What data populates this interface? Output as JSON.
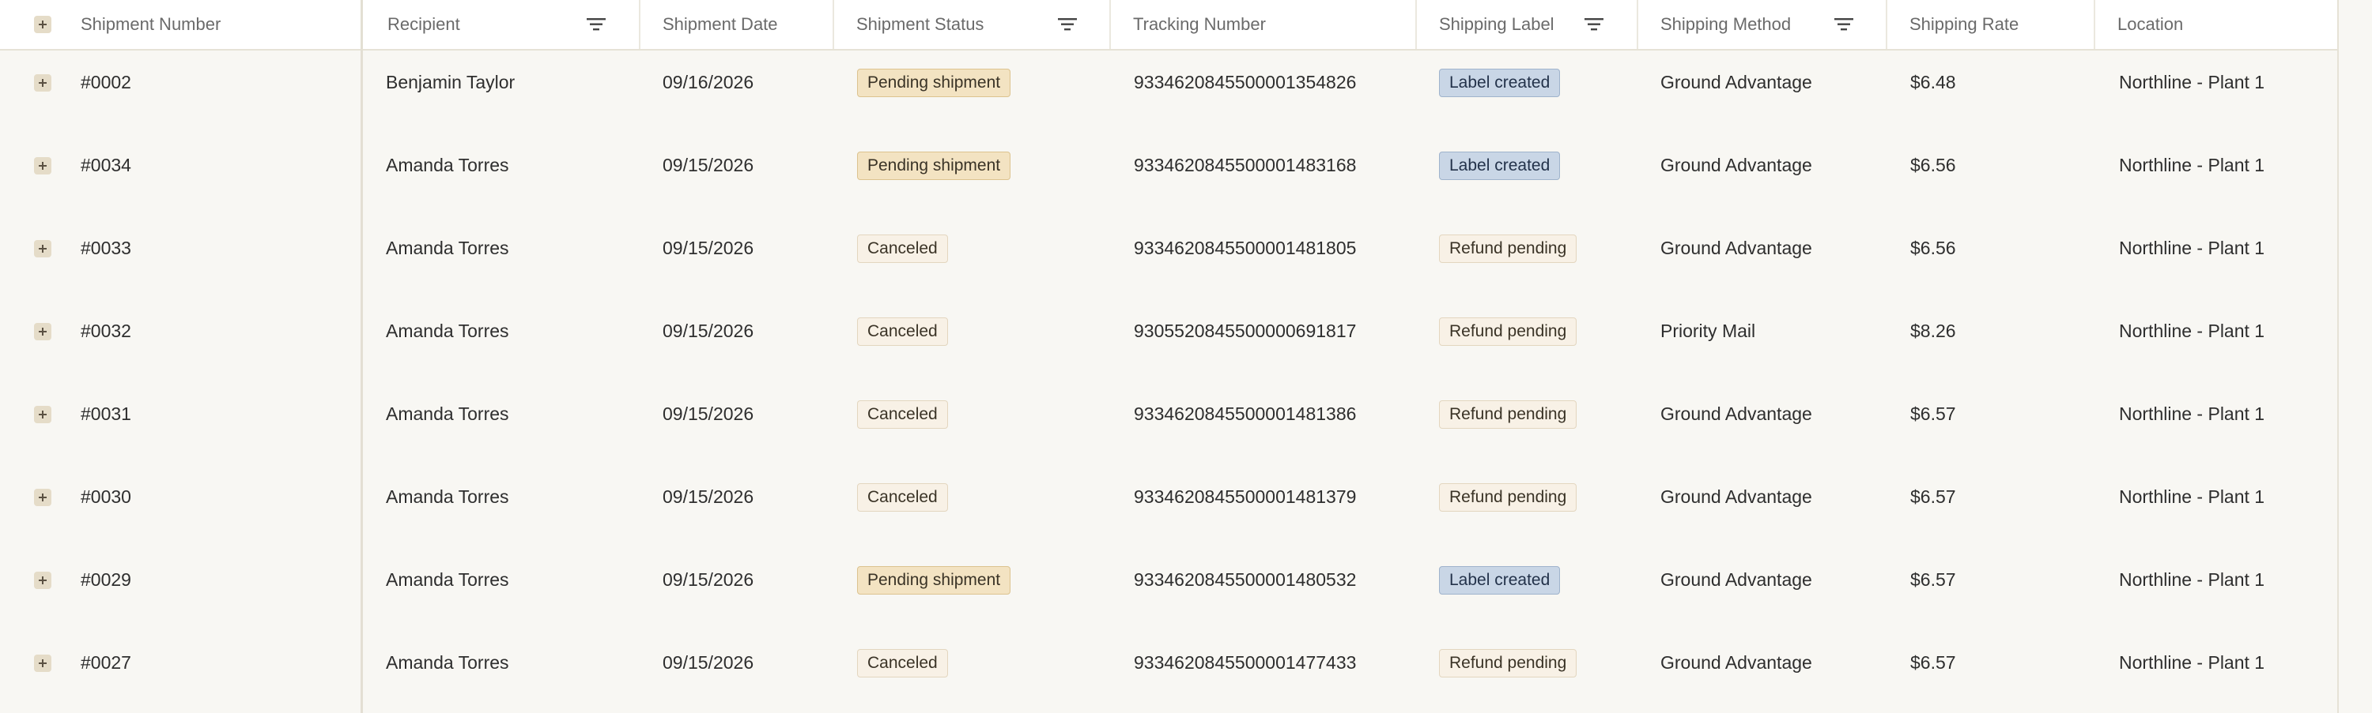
{
  "columns": {
    "shipment_number": "Shipment Number",
    "recipient": "Recipient",
    "shipment_date": "Shipment Date",
    "shipment_status": "Shipment Status",
    "tracking_number": "Tracking Number",
    "shipping_label": "Shipping Label",
    "shipping_method": "Shipping Method",
    "shipping_rate": "Shipping Rate",
    "location": "Location"
  },
  "icons": {
    "expand": "plus-square-icon",
    "filter": "filter-lines-icon"
  },
  "colors": {
    "pending_badge": "#f3e3c2",
    "canceled_badge": "#f8f1e6",
    "label_created_badge": "#c9d6e6",
    "refund_pending_badge": "#f8f1e6",
    "background": "#f8f7f3"
  },
  "rows": [
    {
      "number": "#0002",
      "recipient": "Benjamin Taylor",
      "date": "09/16/2026",
      "status": "Pending shipment",
      "status_kind": "pending",
      "tracking": "9334620845500001354826",
      "label": "Label created",
      "label_kind": "label",
      "method": "Ground Advantage",
      "rate": "$6.48",
      "location": "Northline - Plant 1"
    },
    {
      "number": "#0034",
      "recipient": "Amanda Torres",
      "date": "09/15/2026",
      "status": "Pending shipment",
      "status_kind": "pending",
      "tracking": "9334620845500001483168",
      "label": "Label created",
      "label_kind": "label",
      "method": "Ground Advantage",
      "rate": "$6.56",
      "location": "Northline - Plant 1"
    },
    {
      "number": "#0033",
      "recipient": "Amanda Torres",
      "date": "09/15/2026",
      "status": "Canceled",
      "status_kind": "canceled",
      "tracking": "9334620845500001481805",
      "label": "Refund pending",
      "label_kind": "refund",
      "method": "Ground Advantage",
      "rate": "$6.56",
      "location": "Northline - Plant 1"
    },
    {
      "number": "#0032",
      "recipient": "Amanda Torres",
      "date": "09/15/2026",
      "status": "Canceled",
      "status_kind": "canceled",
      "tracking": "9305520845500000691817",
      "label": "Refund pending",
      "label_kind": "refund",
      "method": "Priority Mail",
      "rate": "$8.26",
      "location": "Northline - Plant 1"
    },
    {
      "number": "#0031",
      "recipient": "Amanda Torres",
      "date": "09/15/2026",
      "status": "Canceled",
      "status_kind": "canceled",
      "tracking": "9334620845500001481386",
      "label": "Refund pending",
      "label_kind": "refund",
      "method": "Ground Advantage",
      "rate": "$6.57",
      "location": "Northline - Plant 1"
    },
    {
      "number": "#0030",
      "recipient": "Amanda Torres",
      "date": "09/15/2026",
      "status": "Canceled",
      "status_kind": "canceled",
      "tracking": "9334620845500001481379",
      "label": "Refund pending",
      "label_kind": "refund",
      "method": "Ground Advantage",
      "rate": "$6.57",
      "location": "Northline - Plant 1"
    },
    {
      "number": "#0029",
      "recipient": "Amanda Torres",
      "date": "09/15/2026",
      "status": "Pending shipment",
      "status_kind": "pending",
      "tracking": "9334620845500001480532",
      "label": "Label created",
      "label_kind": "label",
      "method": "Ground Advantage",
      "rate": "$6.57",
      "location": "Northline - Plant 1"
    },
    {
      "number": "#0027",
      "recipient": "Amanda Torres",
      "date": "09/15/2026",
      "status": "Canceled",
      "status_kind": "canceled",
      "tracking": "9334620845500001477433",
      "label": "Refund pending",
      "label_kind": "refund",
      "method": "Ground Advantage",
      "rate": "$6.57",
      "location": "Northline - Plant 1"
    }
  ]
}
